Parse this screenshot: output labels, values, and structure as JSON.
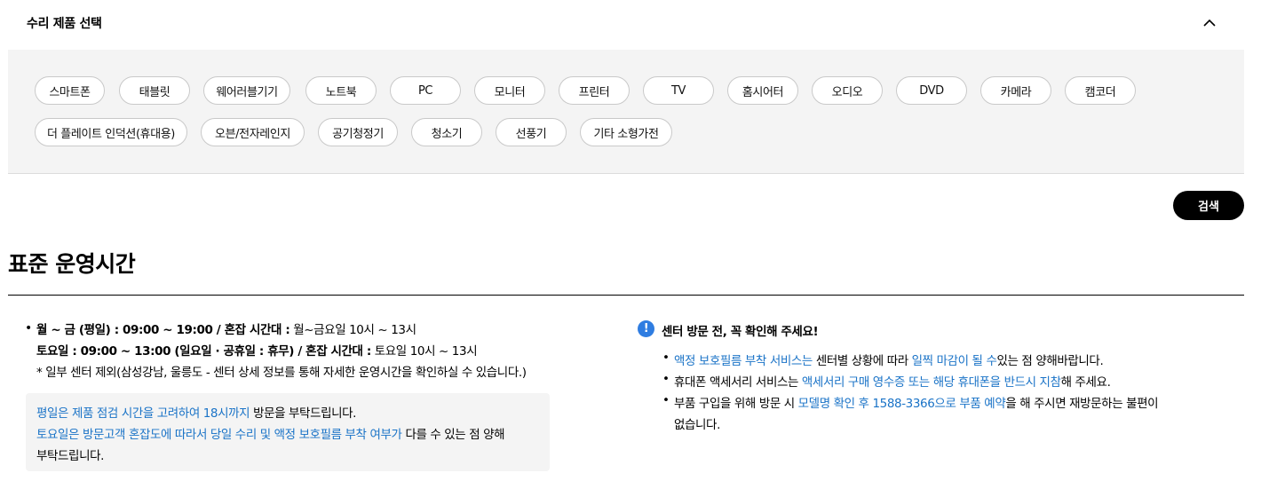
{
  "selector": {
    "title": "수리 제품 선택",
    "chips": [
      "스마트폰",
      "태블릿",
      "웨어러블기기",
      "노트북",
      "PC",
      "모니터",
      "프린터",
      "TV",
      "홈시어터",
      "오디오",
      "DVD",
      "카메라",
      "캠코더",
      "더 플레이트 인덕션(휴대용)",
      "오븐/전자레인지",
      "공기청정기",
      "청소기",
      "선풍기",
      "기타 소형가전"
    ]
  },
  "search_label": "검색",
  "hours": {
    "title": "표준 운영시간",
    "weekday_bold": "월 ~ 금 (평일) : 09:00 ~ 19:00 / 혼잡 시간대 :",
    "weekday_rest": " 월~금요일 10시 ~ 13시",
    "saturday_bold": "토요일 : 09:00 ~ 13:00 (일요일 · 공휴일 : 휴무) / 혼잡 시간대 :",
    "saturday_rest": " 토요일 10시 ~ 13시",
    "footnote": "* 일부 센터 제외(삼성강남, 울릉도 - 센터 상세 정보를 통해 자세한 운영시간을 확인하실 수 있습니다.)",
    "note1_blue": "평일은 제품 점검 시간을 고려하여 18시까지",
    "note1_rest": " 방문을 부탁드립니다.",
    "note2_blue": "토요일은 방문고객 혼잡도에 따라서 당일 수리 및 액정 보호필름 부착 여부가",
    "note2_rest": " 다를 수 있는 점 양해",
    "note3": "부탁드립니다."
  },
  "notice": {
    "title": "센터 방문 전, 꼭 확인해 주세요!",
    "item1_blue_a": "액정 보호필름 부착 서비스는",
    "item1_mid": " 센터별 상황에 따라 ",
    "item1_blue_b": "일찍 마감이 될 수",
    "item1_end": "있는 점 양해바랍니다.",
    "item2_start": "휴대폰 액세서리 서비스는 ",
    "item2_blue": "액세서리 구매 영수증 또는 해당 휴대폰을 반드시 지참",
    "item2_end": "해 주세요.",
    "item3_start": "부품 구입을 위해 방문 시 ",
    "item3_blue": "모델명 확인 후 1588-3366으로 부품 예약",
    "item3_end": "을 해 주시면 재방문하는 불편이",
    "item3_cont": "없습니다."
  },
  "colors": {
    "link_blue": "#1a73c7",
    "info_blue": "#2f7de1",
    "panel_bg": "#f4f4f4"
  }
}
